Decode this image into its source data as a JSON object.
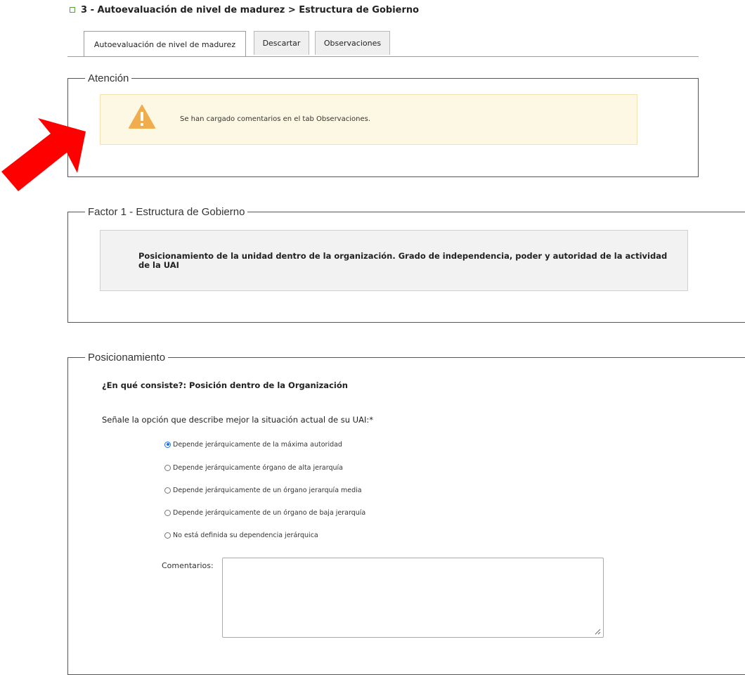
{
  "breadcrumb": {
    "text": "3 - Autoevaluación de nivel de madurez  > Estructura de Gobierno"
  },
  "tabs": [
    {
      "label": "Autoevaluación de nivel de madurez",
      "active": true
    },
    {
      "label": "Descartar",
      "active": false
    },
    {
      "label": "Observaciones",
      "active": false
    }
  ],
  "attention": {
    "legend": "Atención",
    "message": "Se han cargado comentarios en el tab Observaciones."
  },
  "factor": {
    "legend": "Factor 1 - Estructura de Gobierno",
    "description": "Posicionamiento de la unidad dentro de la organización. Grado de independencia, poder y autoridad de la actividad de la UAI"
  },
  "posicionamiento": {
    "legend": "Posicionamiento",
    "question": "¿En qué consiste?: Posición dentro de la Organización",
    "prompt": "Señale la opción que describe mejor la situación actual de su UAI:*",
    "options": [
      {
        "label": "Depende jerárquicamente de la máxima autoridad",
        "checked": true
      },
      {
        "label": "Depende jerárquicamente órgano de alta jerarquía",
        "checked": false
      },
      {
        "label": "Depende jerárquicamente de un órgano jerarquía media",
        "checked": false
      },
      {
        "label": "Depende jerárquicamente de un órgano de baja jerarquía",
        "checked": false
      },
      {
        "label": "No está definida su dependencia jerárquica",
        "checked": false
      }
    ],
    "comments_label": "Comentarios:",
    "comments_value": ""
  },
  "colors": {
    "warning_bg": "#fcf8e3",
    "warning_icon": "#f0ad4e",
    "arrow": "#ff0000",
    "radio_selected": "#1a73e8",
    "breadcrumb_bullet": "#5aa33a"
  }
}
